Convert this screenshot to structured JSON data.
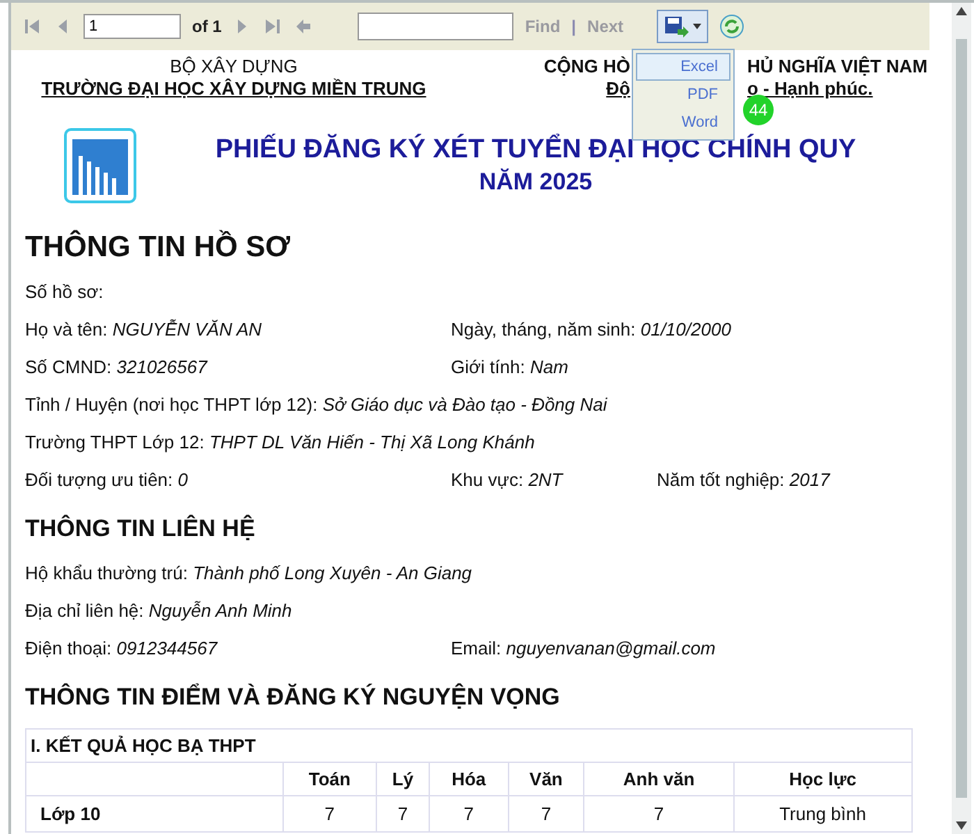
{
  "toolbar": {
    "page_input": "1",
    "page_of": "of 1",
    "find_label": "Find",
    "separator": "|",
    "next_label": "Next",
    "export_menu": {
      "expanded": true,
      "items": [
        {
          "label": "Excel",
          "selected": true
        },
        {
          "label": "PDF",
          "selected": false
        },
        {
          "label": "Word",
          "selected": false
        }
      ]
    },
    "badge": "44"
  },
  "header": {
    "left": [
      "BỘ XÂY DỰNG",
      "TRƯỜNG ĐẠI HỌC XÂY DỰNG MIỀN TRUNG"
    ],
    "right": [
      [
        "CỘNG HÒ",
        "HỦ NGHĨA VIỆT NAM"
      ],
      [
        "Độ",
        "o - Hạnh phúc."
      ]
    ],
    "title": "PHIẾU ĐĂNG KÝ XÉT TUYỂN ĐẠI HỌC CHÍNH QUY",
    "subtitle": "NĂM 2025"
  },
  "sections": [
    {
      "heading": "THÔNG TIN HỒ SƠ",
      "rows": [
        [
          {
            "label": "Số hồ sơ:"
          }
        ],
        [
          {
            "label": "Họ và tên:",
            "value": "NGUYỄN VĂN AN"
          },
          {
            "label": "Ngày, tháng, năm sinh:",
            "value": "01/10/2000"
          }
        ],
        [
          {
            "label": "Số CMND:",
            "value": "321026567"
          },
          {
            "label": "Giới tính:",
            "value": "Nam"
          }
        ],
        [
          {
            "label": "Tỉnh / Huyện (nơi học THPT lớp 12):",
            "value": "Sở Giáo dục và Đào tạo - Đồng Nai"
          }
        ],
        [
          {
            "label": "Trường THPT Lớp 12:",
            "value": "THPT DL Văn Hiến - Thị Xã Long Khánh"
          }
        ],
        [
          {
            "label": "Đối tượng ưu tiên:",
            "value": "0"
          },
          {
            "label": "Khu vực:",
            "value": "2NT"
          },
          {
            "label": "Năm tốt nghiệp:",
            "value": "2017"
          }
        ]
      ]
    },
    {
      "heading": "THÔNG TIN LIÊN HỆ",
      "rows": [
        [
          {
            "label": "Hộ khẩu thường trú:",
            "value": "Thành phố Long Xuyên - An Giang"
          }
        ],
        [
          {
            "label": "Địa chỉ liên hệ:",
            "value": "Nguyễn Anh Minh"
          }
        ],
        [
          {
            "label": "Điện thoại:",
            "value": "0912344567"
          },
          {
            "label": "Email:",
            "value": "nguyenvanan@gmail.com"
          }
        ]
      ]
    },
    {
      "heading": "THÔNG TIN ĐIỂM VÀ ĐĂNG KÝ NGUYỆN VỌNG"
    }
  ],
  "table": {
    "caption": "I. KẾT QUẢ HỌC BẠ THPT",
    "columns": [
      "",
      "Toán",
      "Lý",
      "Hóa",
      "Văn",
      "Anh văn",
      "Học lực"
    ],
    "rows": [
      [
        "Lớp 10",
        "7",
        "7",
        "7",
        "7",
        "7",
        "Trung bình"
      ]
    ]
  }
}
